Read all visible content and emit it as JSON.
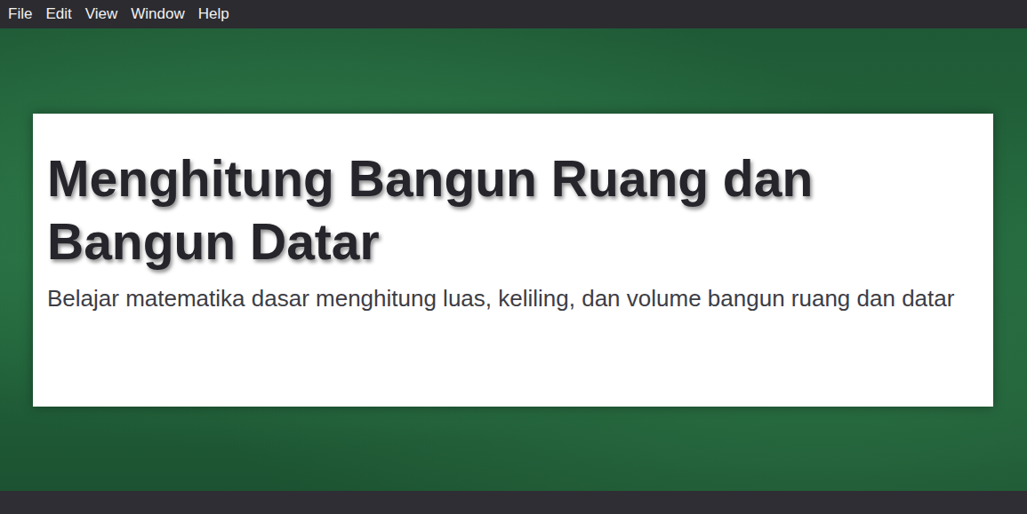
{
  "menu": [
    "File",
    "Edit",
    "View",
    "Window",
    "Help"
  ],
  "hero": {
    "title": "Menghitung Bangun Ruang dan Bangun Datar",
    "subtitle": "Belajar matematika dasar menghitung luas, keliling, dan volume bangun ruang dan datar"
  }
}
